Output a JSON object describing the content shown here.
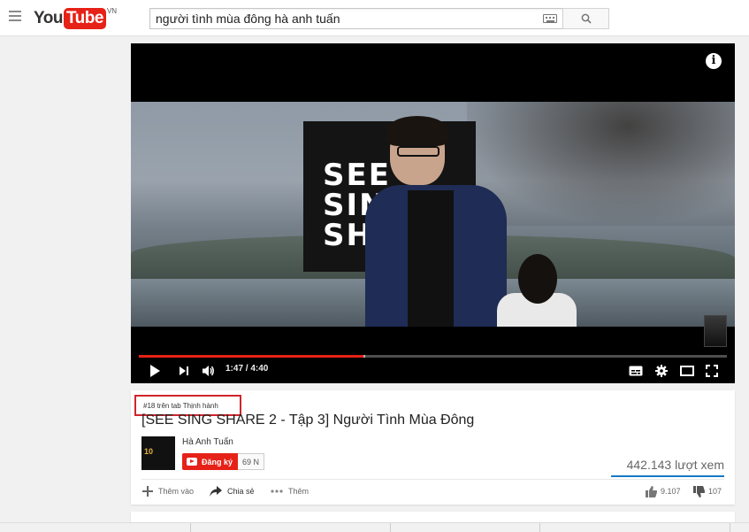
{
  "masthead": {
    "logo_you": "You",
    "logo_tube": "Tube",
    "logo_country": "VN",
    "search_value": "người tình mùa đông hà anh tuấn"
  },
  "player": {
    "sign_text": "SEE\nSING\nSHA",
    "info_glyph": "i",
    "current_time": "1:47",
    "duration": "4:40",
    "time_display": "1:47 / 4:40",
    "progress_played_fraction": 0.382,
    "progress_loaded_fraction": 0.385,
    "icons": [
      "play-icon",
      "next-icon",
      "volume-icon",
      "subtitles-icon",
      "settings-icon",
      "theater-icon",
      "fullscreen-icon"
    ]
  },
  "video": {
    "trending_badge": "#18 trên tab Thịnh hành",
    "title": "[SEE SING SHARE 2 - Tập 3] Người Tình Mùa Đông",
    "views": "442.143 lượt xem",
    "like_ratio": 0.988
  },
  "channel": {
    "thumb_text": "10",
    "name": "Hà Anh Tuấn",
    "subscribe_label": "Đăng ký",
    "subscriber_count": "69 N"
  },
  "actions": {
    "add_to": "Thêm vào",
    "share": "Chia sẻ",
    "more": "Thêm",
    "likes": "9.107",
    "dislikes": "107"
  },
  "colors": {
    "brand_red": "#e62117",
    "badge_border": "#d1242b",
    "sentiment_blue": "#167ac6"
  }
}
